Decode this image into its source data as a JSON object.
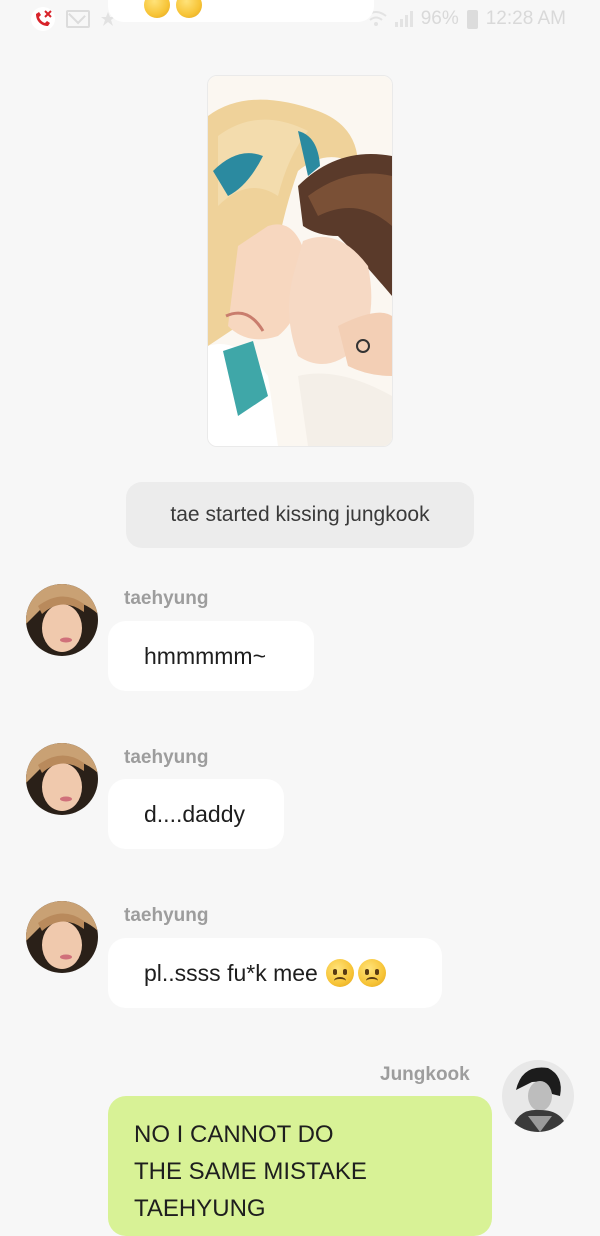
{
  "status_bar": {
    "battery_percent": "96%",
    "time": "12:28 AM",
    "icons": [
      "missed-call-icon",
      "mail-icon",
      "notification-icon",
      "wifi-icon",
      "signal-icon",
      "battery-icon"
    ]
  },
  "top_bubble": {
    "emojis": [
      "smile-emoji",
      "smile-emoji"
    ]
  },
  "narration": {
    "text": "tae started kissing jungkook"
  },
  "messages": [
    {
      "sender": "taehyung",
      "text": "hmmmmm~",
      "emojis": []
    },
    {
      "sender": "taehyung",
      "text": "d....daddy",
      "emojis": []
    },
    {
      "sender": "taehyung",
      "text": "pl..ssss fu*k mee",
      "emojis": [
        "sad-sweat-emoji",
        "worried-emoji"
      ]
    }
  ],
  "my_message": {
    "sender": "Jungkook",
    "lines": [
      "NO I CANNOT DO",
      "THE SAME MISTAKE",
      "TAEHYUNG"
    ]
  },
  "colors": {
    "background": "#f7f7f7",
    "incoming_bubble": "#ffffff",
    "outgoing_bubble": "#d8f296",
    "narration_bg": "#ececec",
    "sender_name": "#9d9d9d",
    "missed_call": "#d8232a"
  }
}
